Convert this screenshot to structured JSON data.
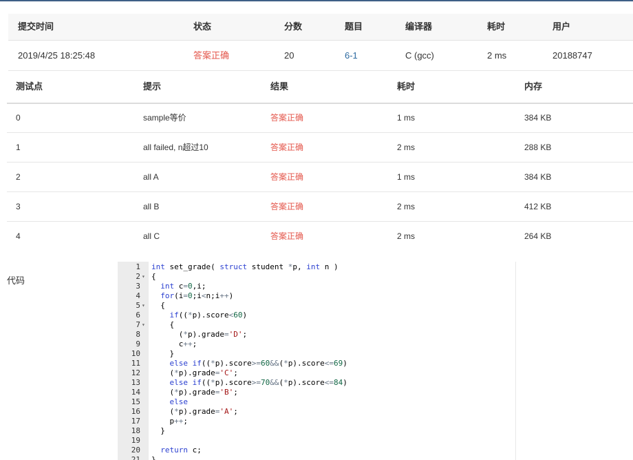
{
  "submission": {
    "headers": [
      "提交时间",
      "状态",
      "分数",
      "题目",
      "编译器",
      "耗时",
      "用户"
    ],
    "row": {
      "time": "2019/4/25 18:25:48",
      "status": "答案正确",
      "score": "20",
      "problem": "6-1",
      "compiler": "C (gcc)",
      "elapsed": "2 ms",
      "user": "20188747"
    }
  },
  "testcases": {
    "headers": [
      "测试点",
      "提示",
      "结果",
      "耗时",
      "内存"
    ],
    "rows": [
      {
        "id": "0",
        "hint": "sample等价",
        "result": "答案正确",
        "time": "1 ms",
        "memory": "384 KB"
      },
      {
        "id": "1",
        "hint": "all failed, n超过10",
        "result": "答案正确",
        "time": "2 ms",
        "memory": "288 KB"
      },
      {
        "id": "2",
        "hint": "all A",
        "result": "答案正确",
        "time": "1 ms",
        "memory": "384 KB"
      },
      {
        "id": "3",
        "hint": "all B",
        "result": "答案正确",
        "time": "2 ms",
        "memory": "412 KB"
      },
      {
        "id": "4",
        "hint": "all C",
        "result": "答案正确",
        "time": "2 ms",
        "memory": "264 KB"
      }
    ]
  },
  "code": {
    "label": "代码",
    "lines": [
      "int set_grade( struct student *p, int n )",
      "{",
      "  int c=0,i;",
      "  for(i=0;i<n;i++)",
      "  {",
      "    if((*p).score<60)",
      "    {",
      "      (*p).grade='D';",
      "      c++;",
      "    }",
      "    else if((*p).score>=60&&(*p).score<=69)",
      "    (*p).grade='C';",
      "    else if((*p).score>=70&&(*p).score<=84)",
      "    (*p).grade='B';",
      "    else",
      "    (*p).grade='A';",
      "    p++;",
      "  }",
      "",
      "  return c;",
      "}"
    ],
    "folds": [
      2,
      5,
      7
    ]
  },
  "colors": {
    "accepted": "#e4574c",
    "link": "#2c6aa0",
    "keyword": "#2a3fd0",
    "topline": "#3e5f86"
  }
}
